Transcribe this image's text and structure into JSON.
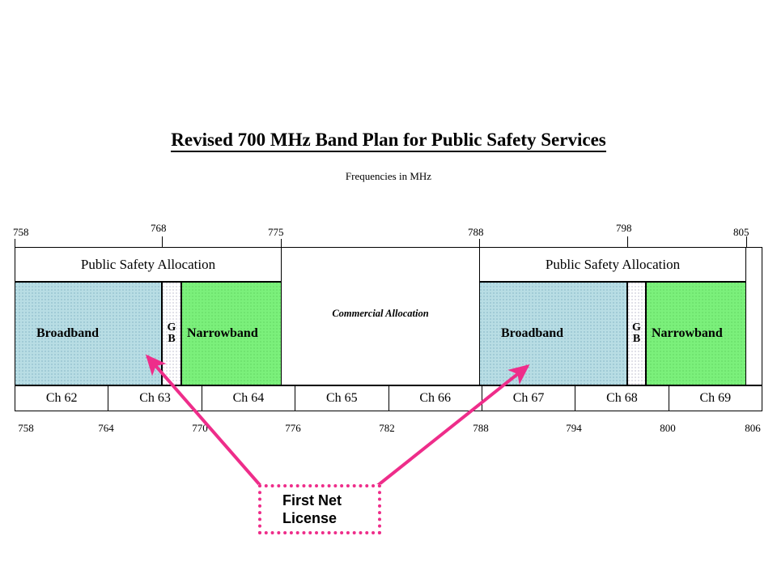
{
  "title": "Revised 700 MHz Band Plan for Public Safety Services",
  "subtitle": "Frequencies in MHz",
  "colors": {
    "broadband": "#b8dde4",
    "narrowband": "#7bf07b",
    "guardband": "#ffffff",
    "callout_pink": "#ee2d8a",
    "frame": "#000000"
  },
  "top_scale": {
    "ticks": [
      {
        "label": "758",
        "mhz": 758
      },
      {
        "label": "768",
        "mhz": 768
      },
      {
        "label": "775",
        "mhz": 775
      },
      {
        "label": "788",
        "mhz": 788
      },
      {
        "label": "798",
        "mhz": 798
      },
      {
        "label": "805",
        "mhz": 805
      }
    ]
  },
  "bottom_scale": {
    "ticks": [
      {
        "label": "758",
        "mhz": 758
      },
      {
        "label": "764",
        "mhz": 764
      },
      {
        "label": "770",
        "mhz": 770
      },
      {
        "label": "776",
        "mhz": 776
      },
      {
        "label": "782",
        "mhz": 782
      },
      {
        "label": "788",
        "mhz": 788
      },
      {
        "label": "794",
        "mhz": 794
      },
      {
        "label": "800",
        "mhz": 800
      },
      {
        "label": "806",
        "mhz": 806
      }
    ]
  },
  "allocations": {
    "public_safety_left": "Public Safety Allocation",
    "public_safety_right": "Public Safety Allocation",
    "commercial": "Commercial Allocation"
  },
  "bands": {
    "left": {
      "broadband": {
        "label": "Broadband",
        "start_mhz": 758,
        "end_mhz": 768
      },
      "guard": {
        "label_line1": "G",
        "label_line2": "B",
        "start_mhz": 768,
        "end_mhz": 769
      },
      "narrowband": {
        "label": "Narrowband",
        "start_mhz": 769,
        "end_mhz": 775
      }
    },
    "right": {
      "broadband": {
        "label": "Broadband",
        "start_mhz": 788,
        "end_mhz": 798
      },
      "guard": {
        "label_line1": "G",
        "label_line2": "B",
        "start_mhz": 798,
        "end_mhz": 799
      },
      "narrowband": {
        "label": "Narrowband",
        "start_mhz": 799,
        "end_mhz": 805
      }
    }
  },
  "channels": [
    {
      "label": "Ch 62"
    },
    {
      "label": "Ch 63"
    },
    {
      "label": "Ch 64"
    },
    {
      "label": "Ch 65"
    },
    {
      "label": "Ch 66"
    },
    {
      "label": "Ch 67"
    },
    {
      "label": "Ch 68"
    },
    {
      "label": "Ch 69"
    }
  ],
  "callout": {
    "line1": "First Net",
    "line2": "License"
  },
  "chart_data": {
    "type": "bar",
    "title": "Revised 700 MHz Band Plan for Public Safety Services",
    "subtitle": "Frequencies in MHz",
    "xlabel": "Frequencies in MHz",
    "ylabel": "",
    "xlim": [
      758,
      806
    ],
    "grid": false,
    "legend": "none",
    "top_axis_ticks": [
      758,
      768,
      775,
      788,
      798,
      805
    ],
    "bottom_axis_ticks": [
      758,
      764,
      770,
      776,
      782,
      788,
      794,
      800,
      806
    ],
    "categories": [
      "Ch 62",
      "Ch 63",
      "Ch 64",
      "Ch 65",
      "Ch 66",
      "Ch 67",
      "Ch 68",
      "Ch 69"
    ],
    "values": [
      6,
      6,
      6,
      6,
      6,
      6,
      6,
      6
    ],
    "annotations": [
      "Public Safety Allocation",
      "Commercial Allocation",
      "Public Safety Allocation",
      "First Net License"
    ],
    "series": [
      {
        "name": "Left Public Safety Allocation",
        "start_mhz": 758,
        "end_mhz": 775,
        "segments": [
          {
            "name": "Broadband",
            "start_mhz": 758,
            "end_mhz": 768,
            "color": "#b8dde4"
          },
          {
            "name": "GB",
            "start_mhz": 768,
            "end_mhz": 769,
            "color": "#ffffff"
          },
          {
            "name": "Narrowband",
            "start_mhz": 769,
            "end_mhz": 775,
            "color": "#7bf07b"
          }
        ]
      },
      {
        "name": "Commercial Allocation",
        "start_mhz": 775,
        "end_mhz": 788,
        "segments": [
          {
            "name": "Commercial Allocation",
            "start_mhz": 775,
            "end_mhz": 788,
            "color": "#ffffff"
          }
        ]
      },
      {
        "name": "Right Public Safety Allocation",
        "start_mhz": 788,
        "end_mhz": 805,
        "segments": [
          {
            "name": "Broadband",
            "start_mhz": 788,
            "end_mhz": 798,
            "color": "#b8dde4"
          },
          {
            "name": "GB",
            "start_mhz": 798,
            "end_mhz": 799,
            "color": "#ffffff"
          },
          {
            "name": "Narrowband",
            "start_mhz": 799,
            "end_mhz": 805,
            "color": "#7bf07b"
          }
        ]
      }
    ]
  }
}
